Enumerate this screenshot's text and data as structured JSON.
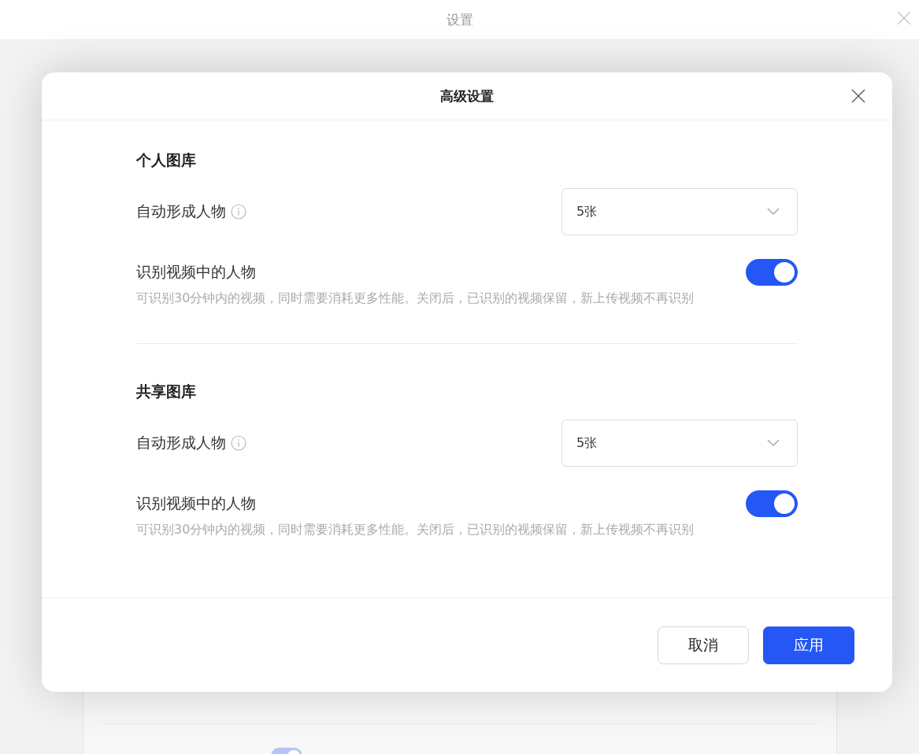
{
  "window": {
    "title": "设置"
  },
  "background_toggle": {
    "on": true
  },
  "dialog": {
    "title": "高级设置",
    "sections": [
      {
        "title": "个人图库",
        "items": [
          {
            "kind": "select",
            "label": "自动形成人物",
            "info": true,
            "value": "5张"
          },
          {
            "kind": "toggle",
            "label": "识别视频中的人物",
            "on": true,
            "description": "可识别30分钟内的视频，同时需要消耗更多性能。关闭后，已识别的视频保留，新上传视频不再识别"
          }
        ]
      },
      {
        "title": "共享图库",
        "items": [
          {
            "kind": "select",
            "label": "自动形成人物",
            "info": true,
            "value": "5张"
          },
          {
            "kind": "toggle",
            "label": "识别视频中的人物",
            "on": true,
            "description": "可识别30分钟内的视频，同时需要消耗更多性能。关闭后，已识别的视频保留，新上传视频不再识别"
          }
        ]
      }
    ],
    "buttons": [
      {
        "label": "取消",
        "primary": false
      },
      {
        "label": "应用",
        "primary": true
      }
    ]
  }
}
